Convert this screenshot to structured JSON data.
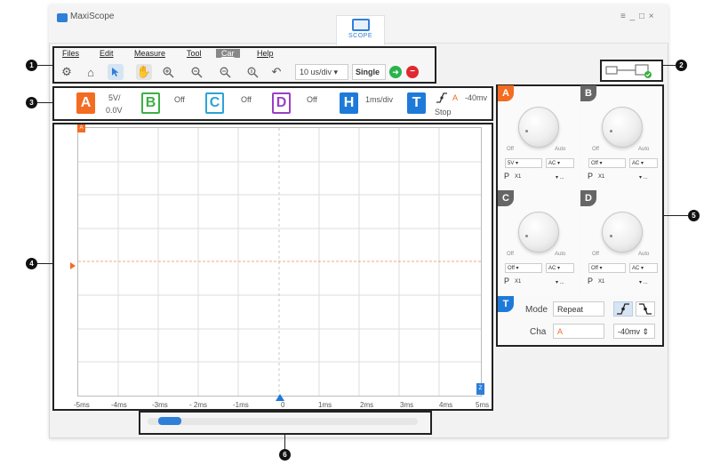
{
  "window": {
    "title": "MaxiScope",
    "controls": "≡ _ □ ×"
  },
  "scope_tab": {
    "label": "SCOPE"
  },
  "menu": {
    "items": [
      "Files",
      "Edit",
      "Measure",
      "Tool",
      "Car",
      "Help"
    ],
    "active": "Car"
  },
  "toolbar": {
    "icons": [
      "settings-icon",
      "home-icon",
      "pointer-icon",
      "hand-icon",
      "zoom-in-icon",
      "zoom-out-icon",
      "zoom-x-icon",
      "zoom-y-icon",
      "undo-icon"
    ],
    "time_div": "10 us/div ▾",
    "single_label": "Single"
  },
  "channels": {
    "a": {
      "letter": "A",
      "line1": "5V/",
      "line2": "0.0V",
      "color": "#f36c21"
    },
    "b": {
      "letter": "B",
      "status": "Off",
      "color": "#3cb043"
    },
    "c": {
      "letter": "C",
      "status": "Off",
      "color": "#2aa3d8"
    },
    "d": {
      "letter": "D",
      "status": "Off",
      "color": "#9a3fc4"
    },
    "h": {
      "letter": "H",
      "value": "1ms/div",
      "color": "#1e7ad9"
    },
    "t": {
      "letter": "T",
      "chan": "A",
      "level": "-40mv",
      "status": "Stop",
      "color": "#1e7ad9"
    }
  },
  "plot": {
    "x_ticks": [
      "-5ms",
      "-4ms",
      "-3ms",
      "- 2ms",
      "-1ms",
      "0",
      "1ms",
      "2ms",
      "3ms",
      "4ms",
      "5ms"
    ],
    "left_marker": "A",
    "right_marker": "Z"
  },
  "knob_panels": [
    {
      "letter": "A",
      "off": "Off",
      "auto": "Auto",
      "range": "5V ▾",
      "coupling": "AC ▾",
      "probe_p": "P",
      "probe": "X1",
      "probe_end": "▾ ..."
    },
    {
      "letter": "B",
      "off": "Off",
      "auto": "Auto",
      "range": "Off ▾",
      "coupling": "AC ▾",
      "probe_p": "P",
      "probe": "X1",
      "probe_end": "▾ ..."
    },
    {
      "letter": "C",
      "off": "Off",
      "auto": "Auto",
      "range": "Off ▾",
      "coupling": "AC ▾",
      "probe_p": "P",
      "probe": "X1",
      "probe_end": "▾ ..."
    },
    {
      "letter": "D",
      "off": "Off",
      "auto": "Auto",
      "range": "Off ▾",
      "coupling": "AC ▾",
      "probe_p": "P",
      "probe": "X1",
      "probe_end": "▾ ..."
    }
  ],
  "trigger": {
    "letter": "T",
    "mode_label": "Mode",
    "mode_value": "Repeat",
    "cha_label": "Cha",
    "cha_value": "A",
    "level": "-40mv ⇕"
  },
  "callouts": [
    "1",
    "2",
    "3",
    "4",
    "5",
    "6"
  ],
  "colors": {
    "accent": "#2f7fd8",
    "trace": "#f36c21",
    "run": "#2bb24c",
    "stop": "#e0282e"
  }
}
